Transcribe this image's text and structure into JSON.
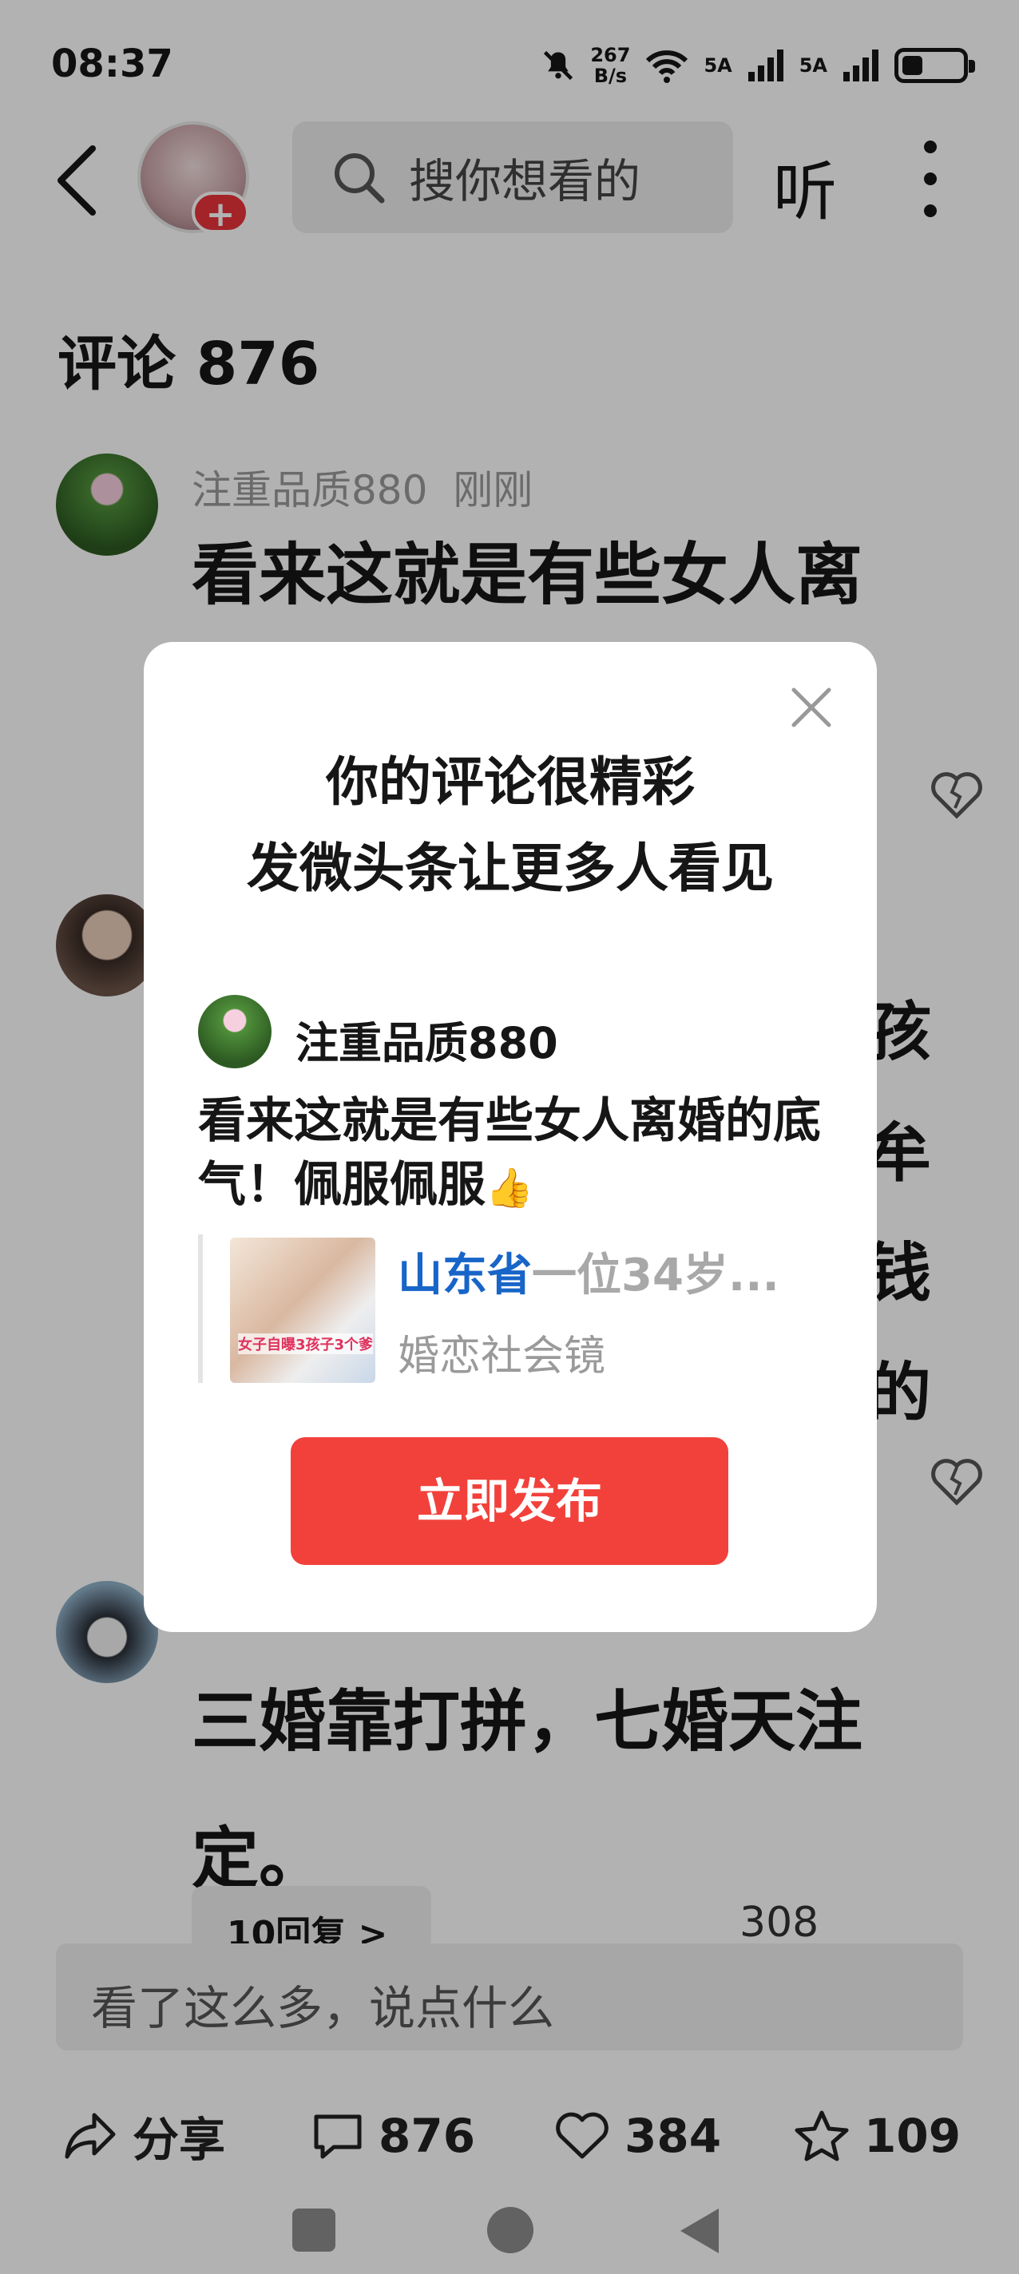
{
  "status_bar": {
    "time": "08:37",
    "net_speed_value": "267",
    "net_speed_unit": "B/s",
    "sim1_label": "5A",
    "sim2_label": "5A",
    "battery_level": 0.35,
    "icons": [
      "bell-mute-icon",
      "wifi-icon",
      "signal-icon",
      "signal-icon",
      "battery-icon"
    ]
  },
  "header": {
    "search_placeholder": "搜你想看的",
    "listen_label": "听",
    "avatar_plus": "+"
  },
  "comments": {
    "title": "评论 876",
    "items": [
      {
        "user": "注重品质880",
        "time": "刚刚",
        "text": "看来这就是有些女人离"
      },
      {
        "partial_chars": [
          "孩",
          "牟",
          "钱",
          "的"
        ]
      },
      {
        "text": "三婚靠打拼，七婚天注定。",
        "reply_label": "10回复 >",
        "likes": "308"
      }
    ]
  },
  "comment_input": {
    "placeholder": "看了这么多，说点什么"
  },
  "bottom_bar": {
    "share_label": "分享",
    "comments_count": "876",
    "likes_count": "384",
    "favorites_count": "109"
  },
  "dialog": {
    "title_line1": "你的评论很精彩",
    "title_line2": "发微头条让更多人看见",
    "user": "注重品质880",
    "comment_text": "看来这就是有些女人离婚的底气！佩服佩服",
    "thumb_emoji": "👍",
    "card_highlight": "山东省",
    "card_title_rest": "一位34岁...",
    "card_source": "婚恋社会镜",
    "thumb_caption": "女子自曝3孩子3个爹",
    "publish_label": "立即发布"
  },
  "colors": {
    "accent": "#f2413b",
    "link_blue": "#1865c8",
    "overlay": "rgba(0,0,0,0.30)"
  }
}
